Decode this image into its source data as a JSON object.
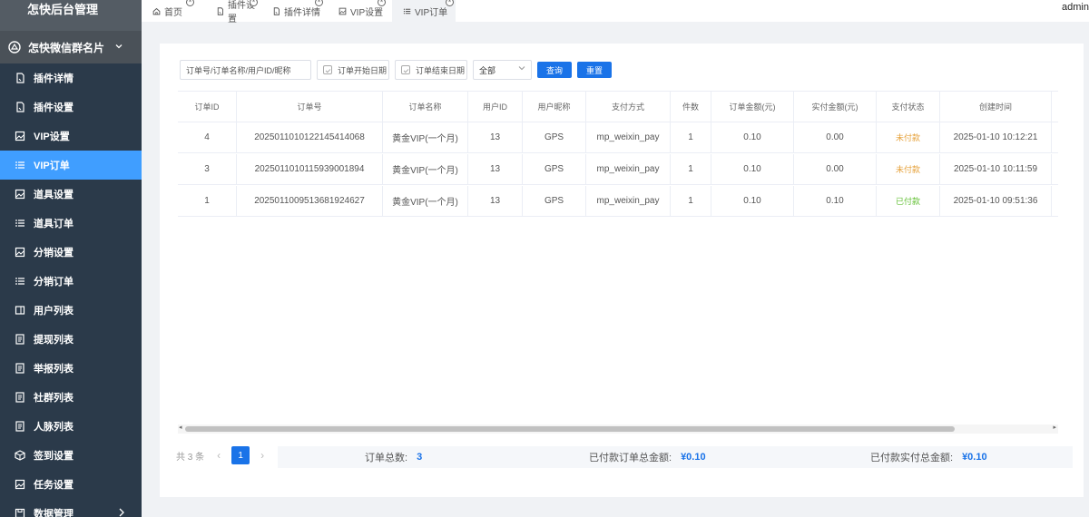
{
  "app": {
    "title": "怎快后台管理"
  },
  "sidebar": {
    "group_label": "怎快微信群名片",
    "items": [
      {
        "label": "插件详情",
        "icon": "doc-icon"
      },
      {
        "label": "插件设置",
        "icon": "doc-icon"
      },
      {
        "label": "VIP设置",
        "icon": "image-icon"
      },
      {
        "label": "VIP订单",
        "icon": "list-icon",
        "active": true
      },
      {
        "label": "道具设置",
        "icon": "image-icon"
      },
      {
        "label": "道具订单",
        "icon": "list-icon"
      },
      {
        "label": "分销设置",
        "icon": "image-icon"
      },
      {
        "label": "分销订单",
        "icon": "list-icon"
      },
      {
        "label": "用户列表",
        "icon": "user-card-icon"
      },
      {
        "label": "提现列表",
        "icon": "doc-lines-icon"
      },
      {
        "label": "举报列表",
        "icon": "doc-lines-icon"
      },
      {
        "label": "社群列表",
        "icon": "doc-lines-icon"
      },
      {
        "label": "人脉列表",
        "icon": "doc-lines-icon"
      },
      {
        "label": "签到设置",
        "icon": "box-icon"
      },
      {
        "label": "任务设置",
        "icon": "image-icon"
      },
      {
        "label": "数据管理",
        "icon": "save-icon",
        "has_children": true
      }
    ]
  },
  "tabs": [
    {
      "label": "首页",
      "icon": "home-icon"
    },
    {
      "label": "插件设置",
      "icon": "doc-icon"
    },
    {
      "label": "插件详情",
      "icon": "doc-icon"
    },
    {
      "label": "VIP设置",
      "icon": "image-icon"
    },
    {
      "label": "VIP订单",
      "icon": "list-icon",
      "active": true
    }
  ],
  "user": {
    "name": "admin"
  },
  "filters": {
    "search_placeholder": "订单号/订单名称/用户ID/昵称",
    "start_date_placeholder": "订单开始日期",
    "end_date_placeholder": "订单结束日期",
    "status_value": "全部",
    "query_label": "查询",
    "reset_label": "重置"
  },
  "table": {
    "columns": [
      "订单ID",
      "订单号",
      "订单名称",
      "用户ID",
      "用户昵称",
      "支付方式",
      "件数",
      "订单金额(元)",
      "实付金额(元)",
      "支付状态",
      "创建时间"
    ],
    "rows": [
      {
        "id": "4",
        "order_no": "20250110101221454140​68",
        "name": "黄金VIP(一个月)",
        "uid": "13",
        "nick": "GPS",
        "pay": "mp_weixin_pay",
        "qty": "1",
        "amount": "0.10",
        "paid_amount": "0.00",
        "status": "未付款",
        "status_type": "unpaid",
        "created": "2025-01-10 10:12:21"
      },
      {
        "id": "3",
        "order_no": "2025011010115939001894",
        "name": "黄金VIP(一个月)",
        "uid": "13",
        "nick": "GPS",
        "pay": "mp_weixin_pay",
        "qty": "1",
        "amount": "0.10",
        "paid_amount": "0.00",
        "status": "未付款",
        "status_type": "unpaid",
        "created": "2025-01-10 10:11:59"
      },
      {
        "id": "1",
        "order_no": "2025011009513681924627",
        "name": "黄金VIP(一个月)",
        "uid": "13",
        "nick": "GPS",
        "pay": "mp_weixin_pay",
        "qty": "1",
        "amount": "0.10",
        "paid_amount": "0.10",
        "status": "已付款",
        "status_type": "paid",
        "created": "2025-01-10 09:51:36"
      }
    ]
  },
  "pagination": {
    "total_text": "共 3 条",
    "current_page": "1",
    "prev": "‹",
    "next": "›"
  },
  "summary": {
    "total_orders_label": "订单总数:",
    "total_orders_value": "3",
    "paid_order_amount_label": "已付款订单总金额:",
    "paid_order_amount_value": "¥0.10",
    "paid_actual_amount_label": "已付款实付总金额:",
    "paid_actual_amount_value": "¥0.10"
  },
  "colors": {
    "accent": "#1a73e8",
    "sidebar_bg": "#545c64",
    "active_menu": "#409eff",
    "unpaid": "#e6a23c",
    "paid": "#67c23a"
  }
}
